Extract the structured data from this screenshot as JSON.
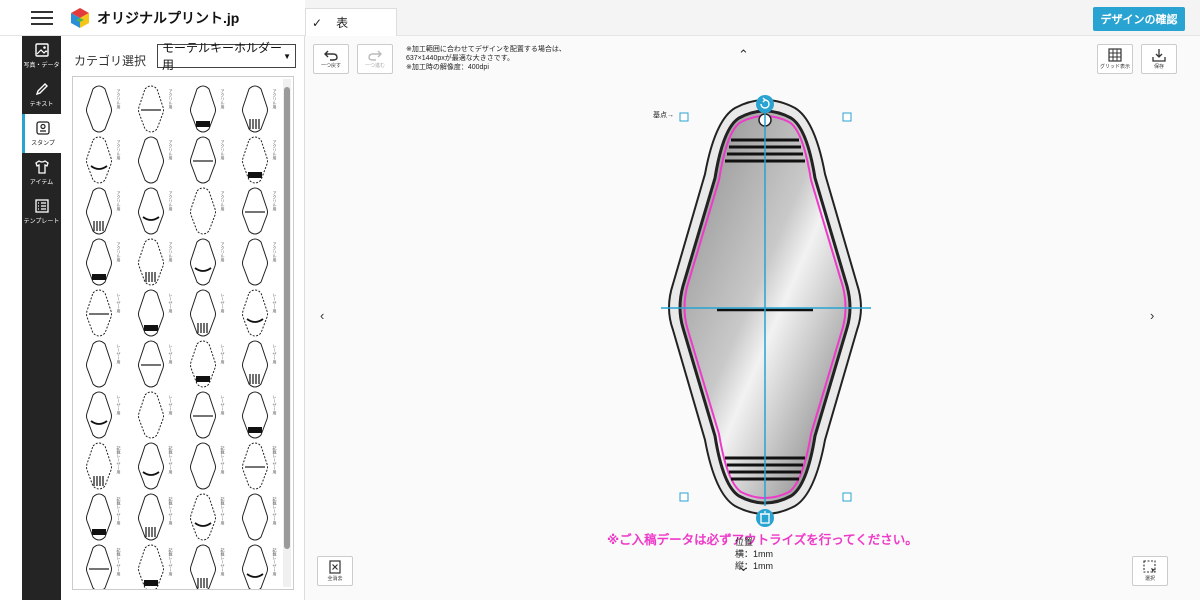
{
  "header": {
    "logo_text": "オリジナルプリント.jp"
  },
  "nav": {
    "items": [
      {
        "label": "写真・データ",
        "icon": "photo-icon"
      },
      {
        "label": "テキスト",
        "icon": "pen-icon"
      },
      {
        "label": "スタンプ",
        "icon": "stamp-icon",
        "active": true
      },
      {
        "label": "アイテム",
        "icon": "shirt-icon"
      },
      {
        "label": "テンプレート",
        "icon": "list-icon"
      }
    ]
  },
  "panel": {
    "category_label": "カテゴリ選択",
    "category_value": "モーテルキーホルダー用",
    "stamp_cells": [
      "アクリル用",
      "レーザー用",
      "記載レーザー用"
    ]
  },
  "topbar": {
    "tab_label": "表",
    "confirm_label": "デザインの確認"
  },
  "canvas": {
    "undo_label": "一つ戻す",
    "redo_label": "一つ進む",
    "grid_label": "グリッド表示",
    "save_label": "保存",
    "clear_label": "全消去",
    "select_label": "選択",
    "note_lines": [
      "※加工範囲に合わせてデザインを配置する場合は、",
      "637×1440pxが最適な大きさです。",
      "※加工時の解像度：400dpi"
    ],
    "base_label": "基点→",
    "warning": "※ご入稿データは必ずアウトラ",
    "warning_tail": "イズを行ってください。",
    "position_title": "位置",
    "position_x": "横：1mm",
    "position_y": "縦：1mm"
  },
  "colors": {
    "accent": "#29a3d1",
    "guide_magenta": "#ee3ac9",
    "nav_bg": "#242424"
  }
}
